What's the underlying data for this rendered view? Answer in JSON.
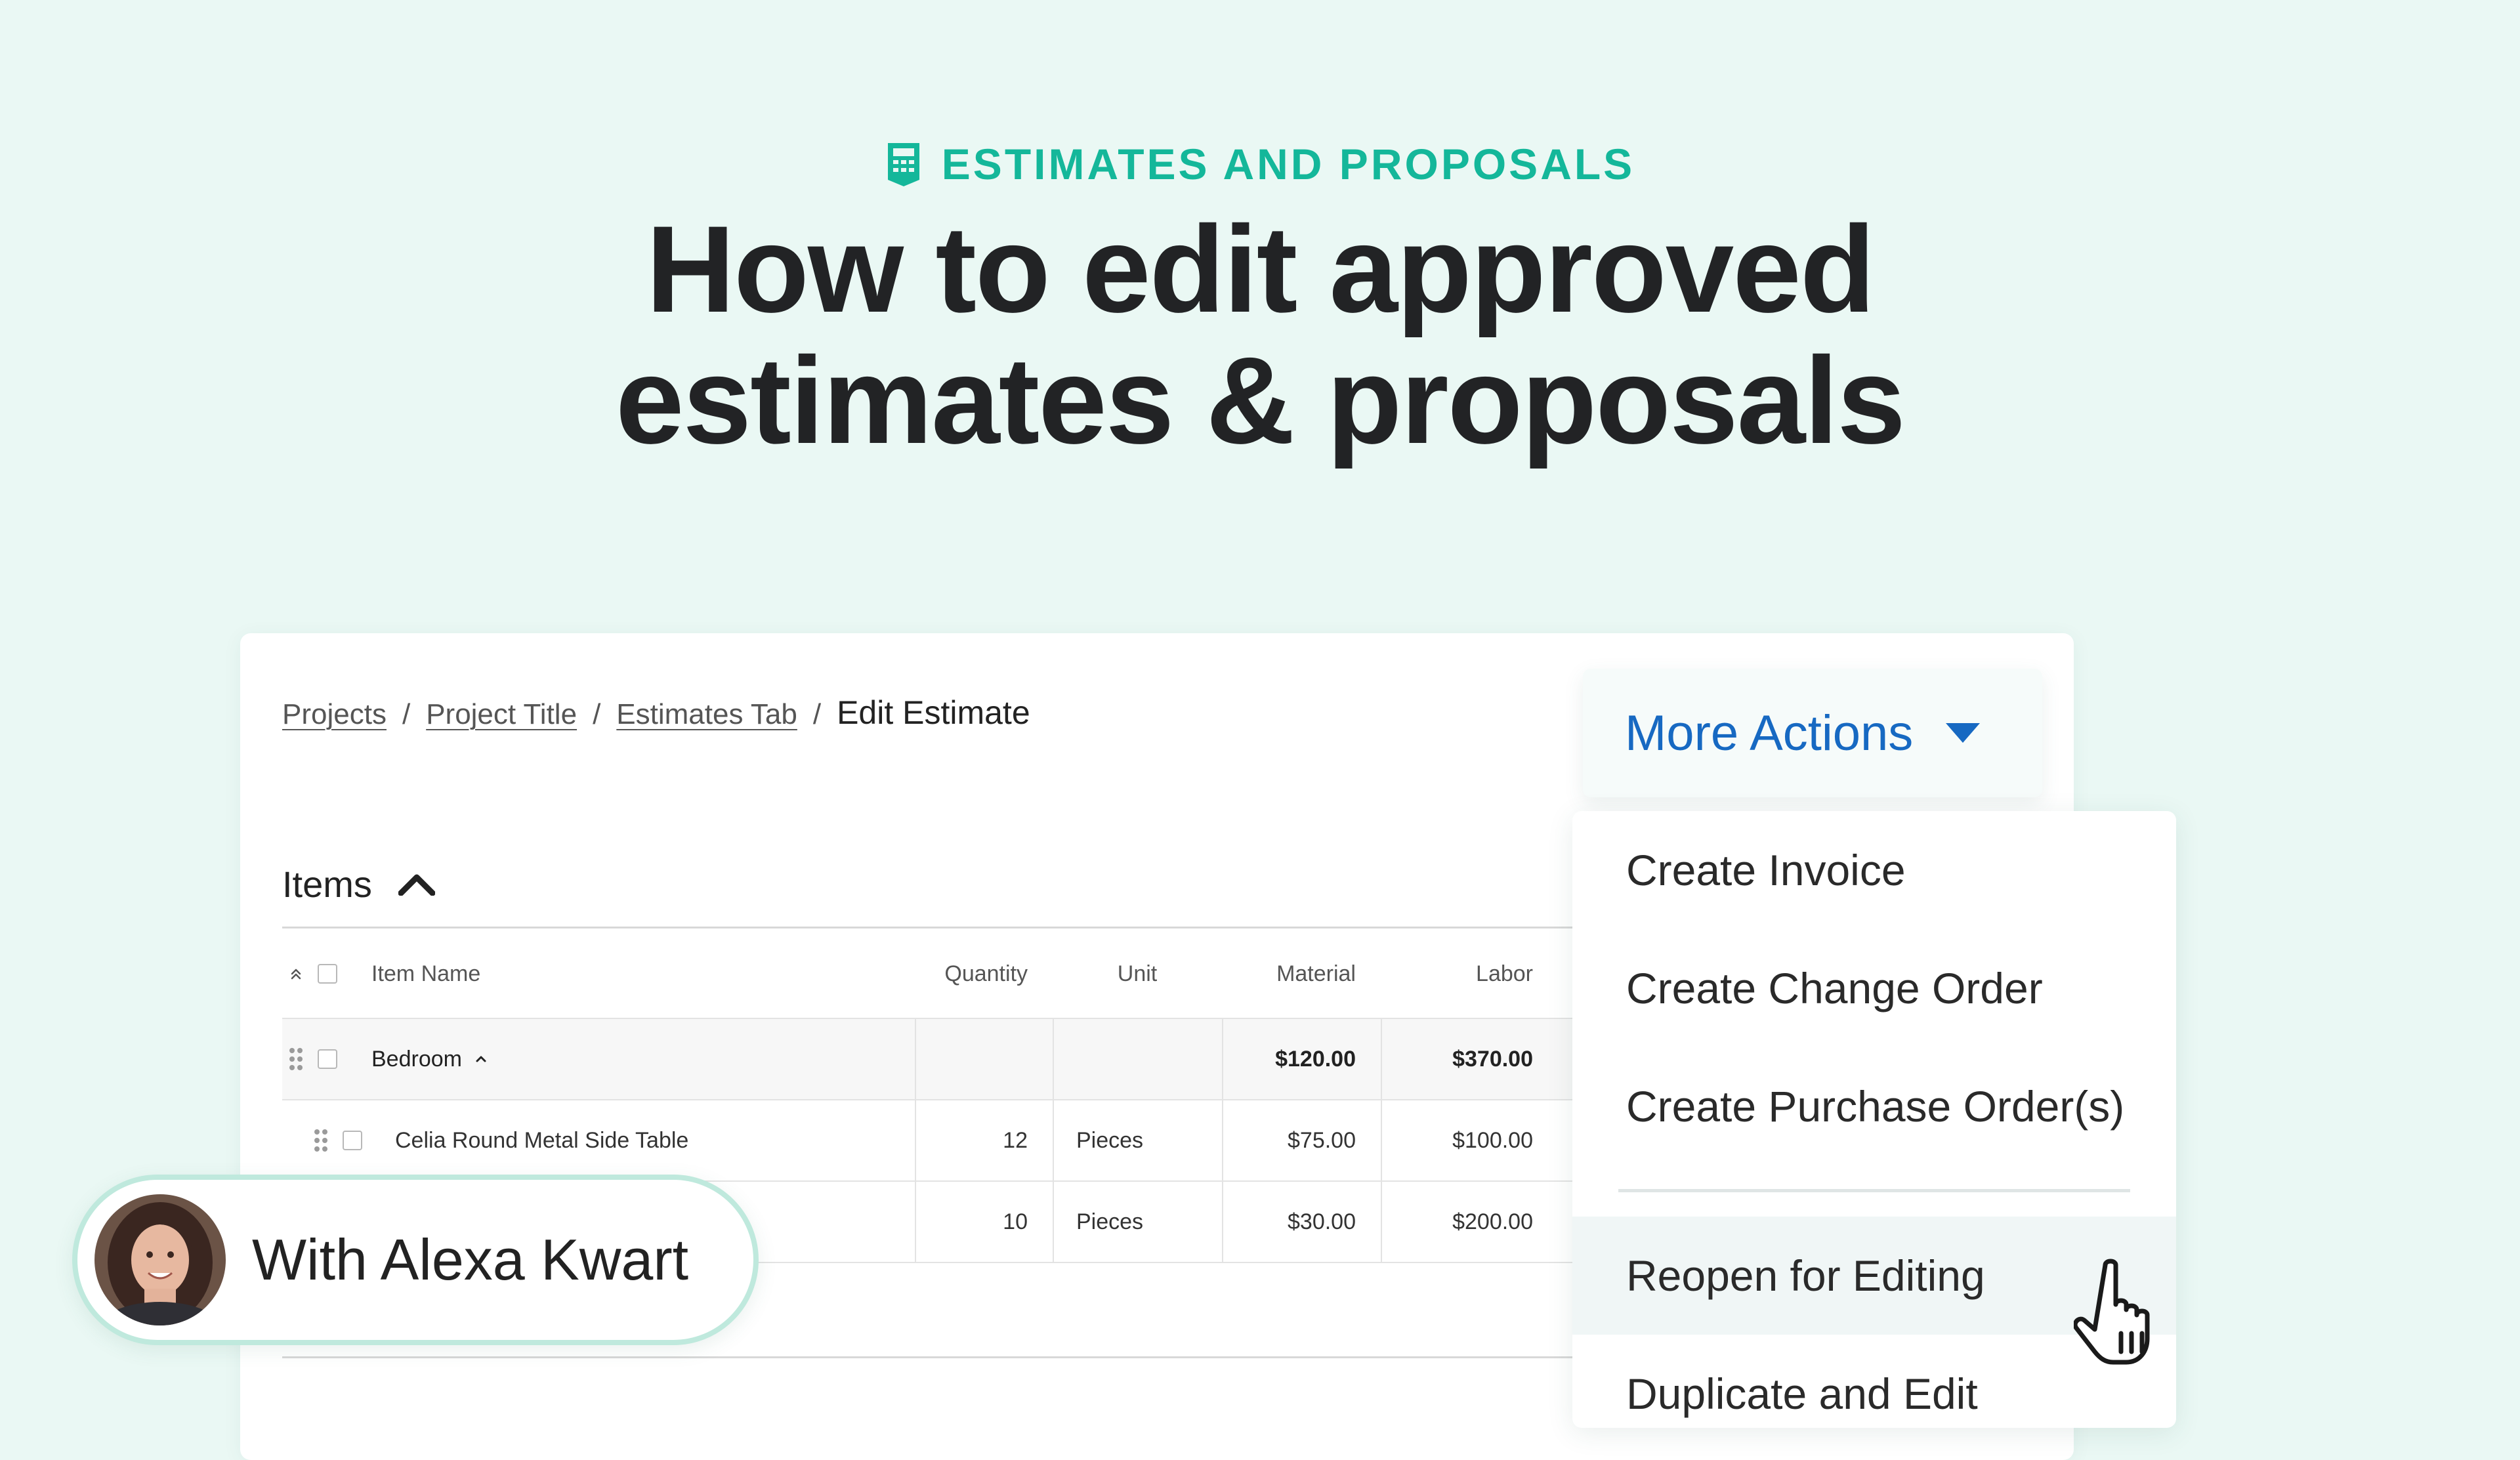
{
  "header": {
    "eyebrow_icon": "calculator-icon",
    "eyebrow": "ESTIMATES AND PROPOSALS",
    "title_line1": "How to edit approved",
    "title_line2": "estimates & proposals"
  },
  "breadcrumb": {
    "items": [
      "Projects",
      "Project Title",
      "Estimates Tab"
    ],
    "separator": "/",
    "current": "Edit Estimate"
  },
  "more_actions": {
    "label": "More Actions",
    "icon": "caret-down-icon"
  },
  "items_section": {
    "title": "Items",
    "icon": "chevron-up-icon"
  },
  "table": {
    "columns": [
      "Item Name",
      "Quantity",
      "Unit",
      "Material",
      "Labor"
    ],
    "group": {
      "name": "Bedroom",
      "material": "$120.00",
      "labor": "$370.00"
    },
    "rows": [
      {
        "name": "Celia Round Metal Side Table",
        "quantity": "12",
        "unit": "Pieces",
        "material": "$75.00",
        "labor": "$100.00"
      },
      {
        "name": "",
        "quantity": "10",
        "unit": "Pieces",
        "material": "$30.00",
        "labor": "$200.00"
      }
    ]
  },
  "menu": {
    "items": [
      "Create Invoice",
      "Create Change Order",
      "Create Purchase Order(s)",
      "Reopen for Editing",
      "Duplicate and Edit"
    ],
    "hovered_item": "Reopen for Editing"
  },
  "presenter": {
    "label": "With Alexa Kwart"
  },
  "colors": {
    "background": "#eaf8f4",
    "accent_teal": "#14b79a",
    "link_blue": "#1769c2",
    "badge_border": "#bfe9dd"
  }
}
